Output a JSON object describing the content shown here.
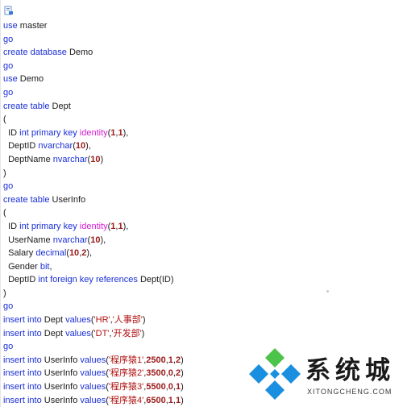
{
  "colors": {
    "keyword": "#1a2fd6",
    "function": "#d21fd2",
    "number": "#9b1a1a",
    "string": "#b01010",
    "plain": "#1a1a1a",
    "logo_blue": "#1a8fe0",
    "logo_green": "#4cc34a"
  },
  "icons": {
    "top_left": "document-icon",
    "watermark_logo": "diamond-logo-icon"
  },
  "code_lines": [
    [
      {
        "t": "use",
        "c": "kw"
      },
      {
        "t": " master",
        "c": ""
      }
    ],
    [
      {
        "t": "go",
        "c": "kw"
      }
    ],
    [
      {
        "t": "create database",
        "c": "kw"
      },
      {
        "t": " Demo",
        "c": ""
      }
    ],
    [
      {
        "t": "go",
        "c": "kw"
      }
    ],
    [
      {
        "t": "use",
        "c": "kw"
      },
      {
        "t": " Demo",
        "c": ""
      }
    ],
    [
      {
        "t": "go",
        "c": "kw"
      }
    ],
    [
      {
        "t": "create table",
        "c": "kw"
      },
      {
        "t": " Dept",
        "c": ""
      }
    ],
    [
      {
        "t": "(",
        "c": ""
      }
    ],
    [
      {
        "t": "  ID ",
        "c": ""
      },
      {
        "t": "int primary key",
        "c": "kw"
      },
      {
        "t": " ",
        "c": ""
      },
      {
        "t": "identity",
        "c": "fn"
      },
      {
        "t": "(",
        "c": ""
      },
      {
        "t": "1",
        "c": "num"
      },
      {
        "t": ",",
        "c": ""
      },
      {
        "t": "1",
        "c": "num"
      },
      {
        "t": "),",
        "c": ""
      }
    ],
    [
      {
        "t": "  DeptID ",
        "c": ""
      },
      {
        "t": "nvarchar",
        "c": "kw"
      },
      {
        "t": "(",
        "c": ""
      },
      {
        "t": "10",
        "c": "num"
      },
      {
        "t": "),",
        "c": ""
      }
    ],
    [
      {
        "t": "  DeptName ",
        "c": ""
      },
      {
        "t": "nvarchar",
        "c": "kw"
      },
      {
        "t": "(",
        "c": ""
      },
      {
        "t": "10",
        "c": "num"
      },
      {
        "t": ")",
        "c": ""
      }
    ],
    [
      {
        "t": ")",
        "c": ""
      }
    ],
    [
      {
        "t": "go",
        "c": "kw"
      }
    ],
    [
      {
        "t": "create table",
        "c": "kw"
      },
      {
        "t": " UserInfo",
        "c": ""
      }
    ],
    [
      {
        "t": "(",
        "c": ""
      }
    ],
    [
      {
        "t": "  ID ",
        "c": ""
      },
      {
        "t": "int primary key",
        "c": "kw"
      },
      {
        "t": " ",
        "c": ""
      },
      {
        "t": "identity",
        "c": "fn"
      },
      {
        "t": "(",
        "c": ""
      },
      {
        "t": "1",
        "c": "num"
      },
      {
        "t": ",",
        "c": ""
      },
      {
        "t": "1",
        "c": "num"
      },
      {
        "t": "),",
        "c": ""
      }
    ],
    [
      {
        "t": "  UserName ",
        "c": ""
      },
      {
        "t": "nvarchar",
        "c": "kw"
      },
      {
        "t": "(",
        "c": ""
      },
      {
        "t": "10",
        "c": "num"
      },
      {
        "t": "),",
        "c": ""
      }
    ],
    [
      {
        "t": "  Salary ",
        "c": ""
      },
      {
        "t": "decimal",
        "c": "kw"
      },
      {
        "t": "(",
        "c": ""
      },
      {
        "t": "10",
        "c": "num"
      },
      {
        "t": ",",
        "c": ""
      },
      {
        "t": "2",
        "c": "num"
      },
      {
        "t": "),",
        "c": ""
      }
    ],
    [
      {
        "t": "  Gender ",
        "c": ""
      },
      {
        "t": "bit",
        "c": "kw"
      },
      {
        "t": ",",
        "c": ""
      }
    ],
    [
      {
        "t": "  DeptID ",
        "c": ""
      },
      {
        "t": "int foreign key references",
        "c": "kw"
      },
      {
        "t": " Dept(ID)",
        "c": ""
      }
    ],
    [
      {
        "t": ")",
        "c": ""
      }
    ],
    [
      {
        "t": "go",
        "c": "kw"
      }
    ],
    [
      {
        "t": "insert into",
        "c": "kw"
      },
      {
        "t": " Dept ",
        "c": ""
      },
      {
        "t": "values",
        "c": "kw"
      },
      {
        "t": "(",
        "c": ""
      },
      {
        "t": "'HR'",
        "c": "str"
      },
      {
        "t": ",",
        "c": ""
      },
      {
        "t": "'人事部'",
        "c": "str"
      },
      {
        "t": ")",
        "c": ""
      }
    ],
    [
      {
        "t": "insert into",
        "c": "kw"
      },
      {
        "t": " Dept ",
        "c": ""
      },
      {
        "t": "values",
        "c": "kw"
      },
      {
        "t": "(",
        "c": ""
      },
      {
        "t": "'DT'",
        "c": "str"
      },
      {
        "t": ",",
        "c": ""
      },
      {
        "t": "'开发部'",
        "c": "str"
      },
      {
        "t": ")",
        "c": ""
      }
    ],
    [
      {
        "t": "go",
        "c": "kw"
      }
    ],
    [
      {
        "t": "insert into",
        "c": "kw"
      },
      {
        "t": " UserInfo ",
        "c": ""
      },
      {
        "t": "values",
        "c": "kw"
      },
      {
        "t": "(",
        "c": ""
      },
      {
        "t": "'程序猿1'",
        "c": "str"
      },
      {
        "t": ",",
        "c": ""
      },
      {
        "t": "2500",
        "c": "num"
      },
      {
        "t": ",",
        "c": ""
      },
      {
        "t": "1",
        "c": "num"
      },
      {
        "t": ",",
        "c": ""
      },
      {
        "t": "2",
        "c": "num"
      },
      {
        "t": ")",
        "c": ""
      }
    ],
    [
      {
        "t": "insert into",
        "c": "kw"
      },
      {
        "t": " UserInfo ",
        "c": ""
      },
      {
        "t": "values",
        "c": "kw"
      },
      {
        "t": "(",
        "c": ""
      },
      {
        "t": "'程序猿2'",
        "c": "str"
      },
      {
        "t": ",",
        "c": ""
      },
      {
        "t": "3500",
        "c": "num"
      },
      {
        "t": ",",
        "c": ""
      },
      {
        "t": "0",
        "c": "num"
      },
      {
        "t": ",",
        "c": ""
      },
      {
        "t": "2",
        "c": "num"
      },
      {
        "t": ")",
        "c": ""
      }
    ],
    [
      {
        "t": "insert into",
        "c": "kw"
      },
      {
        "t": " UserInfo ",
        "c": ""
      },
      {
        "t": "values",
        "c": "kw"
      },
      {
        "t": "(",
        "c": ""
      },
      {
        "t": "'程序猿3'",
        "c": "str"
      },
      {
        "t": ",",
        "c": ""
      },
      {
        "t": "5500",
        "c": "num"
      },
      {
        "t": ",",
        "c": ""
      },
      {
        "t": "0",
        "c": "num"
      },
      {
        "t": ",",
        "c": ""
      },
      {
        "t": "1",
        "c": "num"
      },
      {
        "t": ")",
        "c": ""
      }
    ],
    [
      {
        "t": "insert into",
        "c": "kw"
      },
      {
        "t": " UserInfo ",
        "c": ""
      },
      {
        "t": "values",
        "c": "kw"
      },
      {
        "t": "(",
        "c": ""
      },
      {
        "t": "'程序猿4'",
        "c": "str"
      },
      {
        "t": ",",
        "c": ""
      },
      {
        "t": "6500",
        "c": "num"
      },
      {
        "t": ",",
        "c": ""
      },
      {
        "t": "1",
        "c": "num"
      },
      {
        "t": ",",
        "c": ""
      },
      {
        "t": "1",
        "c": "num"
      },
      {
        "t": ")",
        "c": ""
      }
    ]
  ],
  "watermark": {
    "chinese": "系统城",
    "english": "XITONGCHENG.COM"
  }
}
